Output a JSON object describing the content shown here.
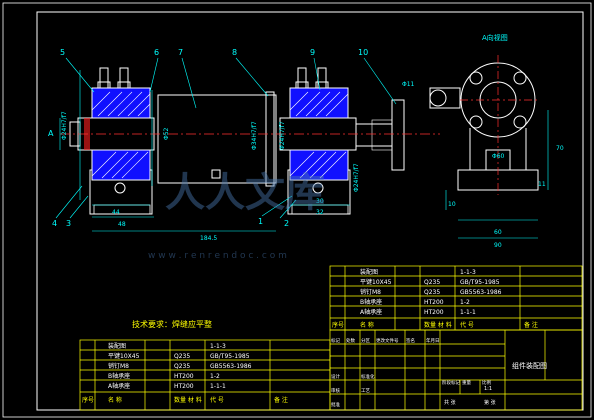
{
  "colors": {
    "background": "#000000",
    "frame": "#ffffff",
    "part_outline": "#ffffff",
    "table_lines": "#ffff00",
    "table_text": "#ffffff",
    "yellow_text": "#ffff00",
    "dimension": "#00ffff",
    "centerline": "#ff3030",
    "hatch": "#ffffff",
    "section_fill": "#0000ff",
    "leader": "#00ffff",
    "watermark": "#4a78b0"
  },
  "balloons": {
    "b5": "5",
    "b6": "6",
    "b7": "7",
    "b8": "8",
    "b9": "9",
    "b10": "10",
    "b4": "4",
    "b3": "3",
    "b2": "2",
    "b1": "1"
  },
  "dimensions": {
    "d_a_side": "A",
    "d_phi_left": "Φ24H7/f7",
    "d_phi_mid": "Φ52",
    "d_44": "44",
    "d_48": "48",
    "d_184": "184.5",
    "d_30": "30",
    "d_32": "32",
    "d_phi11": "Φ11",
    "d_phi60": "Φ60",
    "d_70": "70",
    "d_11": "11",
    "d_10": "10",
    "d_90": "90",
    "d_60": "60",
    "d_phi_r": "Φ24H7/f7",
    "d_phi_r2": "Φ14H7/f7",
    "d_phi_m1": "Φ34H7/f7",
    "d_phi_m2": "Φ24H7/f7",
    "d_phi_small": "Φ24H7/f7",
    "view_a": "A向视图",
    "cut_a": "A"
  },
  "watermark": {
    "main": "人人文库",
    "url": "w w w . r e n r e n d o c . c o m"
  },
  "tech_note": "技术要求：焊缝应平整",
  "bom_right": {
    "rows": [
      [
        "装配图",
        "",
        "1-1-3",
        ""
      ],
      [
        "平键10X45",
        "Q235",
        "GB/T95-1985",
        ""
      ],
      [
        "销钉M8",
        "Q235",
        "GB5563-1986",
        ""
      ],
      [
        "B轴承座",
        "HT200",
        "1-2",
        ""
      ],
      [
        "A轴承座",
        "HT200",
        "1-1-1",
        ""
      ]
    ],
    "header": [
      "序号",
      "名 称",
      "数量 材 料",
      "代 号",
      "备 注"
    ]
  },
  "bom_left": {
    "rows": [
      [
        "装配图",
        "",
        "1-1-3",
        ""
      ],
      [
        "平键10X45",
        "Q235",
        "GB/T95-1985",
        ""
      ],
      [
        "销钉M8",
        "Q235",
        "GB5563-1986",
        ""
      ],
      [
        "B轴承座",
        "HT200",
        "1-2",
        ""
      ],
      [
        "A轴承座",
        "HT200",
        "1-1-1",
        ""
      ]
    ],
    "header": [
      "序号",
      "名 称",
      "数量 材 料",
      "代 号",
      "备 注"
    ]
  },
  "title_block": {
    "drawing_name": "组件装配图",
    "scale": "1:1",
    "labels": [
      "标记",
      "处数",
      "分区",
      "更改文件号",
      "签名",
      "年月日",
      "设计",
      "标准化",
      "审核",
      "工艺",
      "批准"
    ],
    "stage_labels": [
      "阶段标记",
      "重量",
      "比例"
    ],
    "sheet": [
      "共 张",
      "第 张"
    ]
  }
}
